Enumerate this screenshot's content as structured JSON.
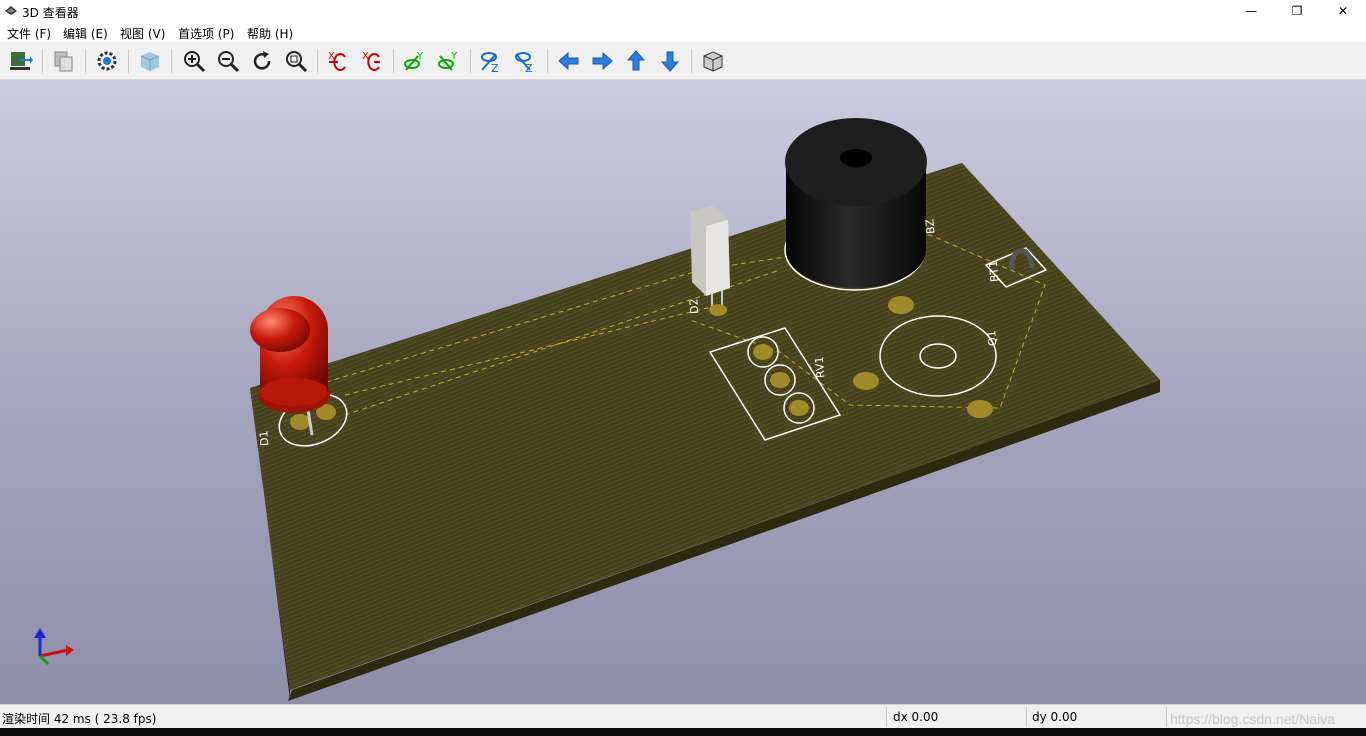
{
  "window": {
    "title": "3D 查看器",
    "minimize_glyph": "—",
    "restore_glyph": "❐",
    "close_glyph": "✕"
  },
  "menu": [
    {
      "label": "文件 (F)"
    },
    {
      "label": "编辑 (E)"
    },
    {
      "label": "视图 (V)"
    },
    {
      "label": "首选项 (P)"
    },
    {
      "label": "帮助 (H)"
    }
  ],
  "toolbar": {
    "icons": [
      "reload-board-icon",
      "copy-image-icon",
      "settings-icon",
      "raytracing-icon",
      "zoom-in-icon",
      "zoom-out-icon",
      "redraw-icon",
      "zoom-fit-icon",
      "rotate-x-cw-icon",
      "rotate-x-ccw-icon",
      "rotate-y-cw-icon",
      "rotate-y-ccw-icon",
      "rotate-z-cw-icon",
      "rotate-z-ccw-icon",
      "pan-left-icon",
      "pan-right-icon",
      "pan-up-icon",
      "pan-down-icon",
      "ortho-cube-icon"
    ]
  },
  "pcb": {
    "refs": [
      "D1",
      "D2",
      "RV1",
      "BZ",
      "Q1",
      "BT1"
    ],
    "colors": {
      "board": "#46411e",
      "board_edge": "#2e2a10",
      "silkscreen": "#ffffff",
      "pad": "#a08a2a",
      "led": "#c81a0c",
      "buzzer": "#1a1a1a"
    }
  },
  "status": {
    "render_time": "渲染时间 42 ms ( 23.8 fps)",
    "dx": "dx 0.00",
    "dy": "dy 0.00",
    "watermark": "https://blog.csdn.net/Naiva"
  }
}
